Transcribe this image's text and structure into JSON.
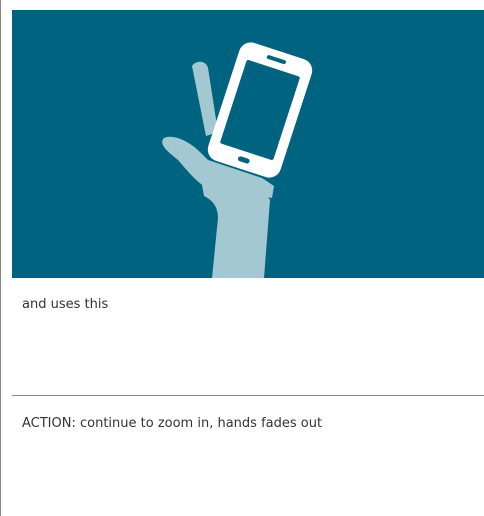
{
  "storyboard": {
    "illustration": {
      "description_icon": "hand-holding-phone-icon",
      "background_color": "#006480",
      "hand_color": "#a4c8d2",
      "phone_color": "#ffffff",
      "screen_color": "#006480"
    },
    "frame_1_caption": "and uses this",
    "frame_2_caption": "ACTION: continue to zoom in, hands fades out"
  }
}
